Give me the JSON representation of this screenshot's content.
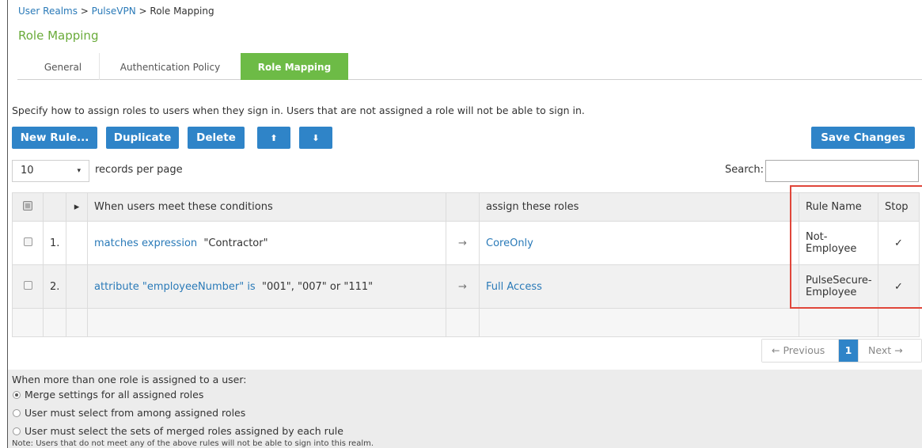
{
  "breadcrumb": {
    "item1": "User Realms",
    "sep1": " > ",
    "item2": "PulseVPN",
    "sep2": " > ",
    "current": "Role Mapping"
  },
  "page_title": "Role Mapping",
  "tabs": {
    "general": "General",
    "auth_policy": "Authentication Policy",
    "role_mapping": "Role Mapping"
  },
  "description": "Specify how to assign roles to users when they sign in. Users that are not assigned a role will not be able to sign in.",
  "toolbar": {
    "new_rule": "New Rule...",
    "duplicate": "Duplicate",
    "delete": "Delete",
    "move_up": "⬆",
    "move_down": "⬇",
    "save": "Save Changes"
  },
  "pagesize": {
    "value": "10",
    "caret": "▾",
    "label": "records per page"
  },
  "search": {
    "label": "Search:",
    "value": ""
  },
  "table": {
    "header": {
      "expand": "▸",
      "conditions": "When users meet these conditions",
      "roles": "assign these roles",
      "rule_name": "Rule Name",
      "stop": "Stop"
    },
    "rows": [
      {
        "num": "1.",
        "cond_link": "matches expression",
        "cond_value": "\"Contractor\"",
        "arrow": "→",
        "role": "CoreOnly",
        "rule_name": "Not-Employee",
        "stop": "✓"
      },
      {
        "num": "2.",
        "cond_link": "attribute \"employeeNumber\" is",
        "cond_value": "\"001\", \"007\" or \"111\"",
        "arrow": "→",
        "role": "Full Access",
        "rule_name": "PulseSecure-Employee",
        "stop": "✓"
      }
    ]
  },
  "pager": {
    "prev": "← Previous",
    "current": "1",
    "next": "Next →"
  },
  "roles_policy": {
    "title": "When more than one role is assigned to a user:",
    "options": [
      "Merge settings for all assigned roles",
      "User must select from among assigned roles",
      "User must select the sets of merged roles assigned by each rule"
    ],
    "selected_index": 0
  },
  "note": "Note: Users that do not meet any of the above rules will not be able to sign into this realm.",
  "colors": {
    "accent_blue": "#2f84c8",
    "tab_green": "#6dbb46",
    "title_green": "#6aab3a",
    "highlight_red": "#e0463a"
  }
}
